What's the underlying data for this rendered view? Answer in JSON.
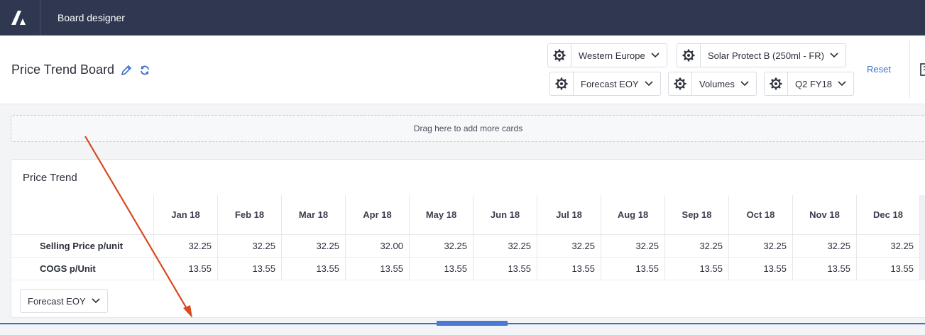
{
  "app": {
    "logo_icon": "company-logo-icon",
    "title": "Board designer"
  },
  "header": {
    "board_title": "Price Trend Board",
    "filters": [
      {
        "value": "Western Europe"
      },
      {
        "value": "Solar Protect B (250ml - FR)"
      },
      {
        "value": "Forecast EOY"
      },
      {
        "value": "Volumes"
      },
      {
        "value": "Q2 FY18"
      }
    ],
    "reset_label": "Reset"
  },
  "dropzone_text": "Drag here to add more cards",
  "card": {
    "title": "Price Trend",
    "columns": [
      "Jan 18",
      "Feb 18",
      "Mar 18",
      "Apr 18",
      "May 18",
      "Jun 18",
      "Jul 18",
      "Aug 18",
      "Sep 18",
      "Oct 18",
      "Nov 18",
      "Dec 18"
    ],
    "rows": [
      {
        "label": "Selling Price p/unit",
        "values": [
          "32.25",
          "32.25",
          "32.25",
          "32.00",
          "32.25",
          "32.25",
          "32.25",
          "32.25",
          "32.25",
          "32.25",
          "32.25",
          "32.25"
        ]
      },
      {
        "label": "COGS p/Unit",
        "values": [
          "13.55",
          "13.55",
          "13.55",
          "13.55",
          "13.55",
          "13.55",
          "13.55",
          "13.55",
          "13.55",
          "13.55",
          "13.55",
          "13.55"
        ]
      }
    ],
    "dropdown_value": "Forecast EOY"
  },
  "colors": {
    "topbar": "#2f3850",
    "accent": "#3b6fc9",
    "annotation_arrow": "#d9481f"
  }
}
